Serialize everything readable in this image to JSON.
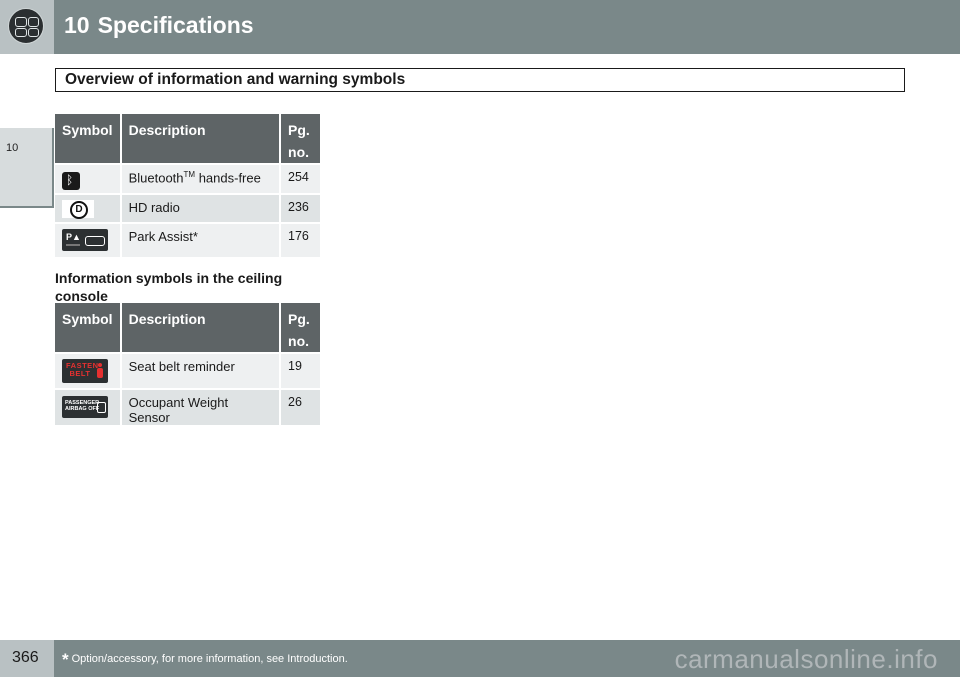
{
  "header": {
    "chapter_number": "10",
    "chapter_title": "Specifications"
  },
  "side_tab": {
    "label": "10"
  },
  "section_title": "Overview of information and warning symbols",
  "table1": {
    "headers": {
      "symbol": "Symbol",
      "description": "Description",
      "page_line1": "Pg.",
      "page_line2": "no."
    },
    "rows": [
      {
        "icon": "bluetooth-icon",
        "description": "Bluetooth",
        "description_sup": "TM",
        "description_suffix": " hands-free",
        "page": "254"
      },
      {
        "icon": "hd-radio-icon",
        "description": "HD radio",
        "page": "236"
      },
      {
        "icon": "park-assist-icon",
        "description": "Park Assist*",
        "page": "176"
      }
    ]
  },
  "subheading": "Information symbols in the ceiling console",
  "table2": {
    "headers": {
      "symbol": "Symbol",
      "description": "Description",
      "page_line1": "Pg.",
      "page_line2": "no."
    },
    "rows": [
      {
        "icon": "fasten-belt-icon",
        "icon_text_1": "FASTEN",
        "icon_text_2": "BELT",
        "description": "Seat belt reminder",
        "page": "19"
      },
      {
        "icon": "passenger-airbag-off-icon",
        "icon_text_1": "PASSENGER",
        "icon_text_2": "AIRBAG OFF",
        "description": "Occupant Weight Sensor",
        "page": "26"
      }
    ]
  },
  "footer": {
    "page_number": "366",
    "asterisk": "*",
    "footnote": "Option/accessory, for more information, see Introduction."
  },
  "watermark": "carmanualsonline.info",
  "colors": {
    "header_bar": "#7a8889",
    "table_header": "#5e6466",
    "row_light": "#eef0f1",
    "row_dark": "#dfe3e4"
  }
}
